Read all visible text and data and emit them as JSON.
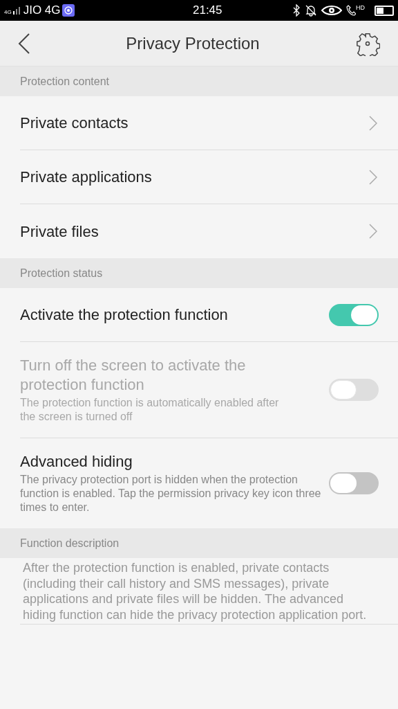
{
  "status_bar": {
    "network": "4G",
    "carrier": "JIO 4G",
    "time": "21:45",
    "call_badge": "HD"
  },
  "header": {
    "title": "Privacy Protection"
  },
  "sections": [
    {
      "heading": "Protection content",
      "items": [
        {
          "kind": "nav",
          "label": "Private contacts"
        },
        {
          "kind": "nav",
          "label": "Private applications"
        },
        {
          "kind": "nav",
          "label": "Private files"
        }
      ]
    },
    {
      "heading": "Protection status",
      "items": [
        {
          "kind": "toggle",
          "label": "Activate the protection function",
          "on": true,
          "disabled": false
        },
        {
          "kind": "toggle",
          "label": "Turn off the screen to activate the protection function",
          "description": "The protection function is automatically enabled after the screen is turned off",
          "on": false,
          "disabled": true
        },
        {
          "kind": "toggle",
          "label": "Advanced hiding",
          "description": "The privacy protection port is hidden when the protection function is enabled. Tap the permission privacy key icon three times to enter.",
          "on": false,
          "disabled": false
        }
      ]
    },
    {
      "heading": "Function description",
      "items": [
        {
          "kind": "text",
          "label": "After the protection function is enabled, private contacts (including their call history and SMS messages), private applications and private files will be hidden. The advanced hiding function can hide the privacy protection application port."
        }
      ]
    }
  ]
}
